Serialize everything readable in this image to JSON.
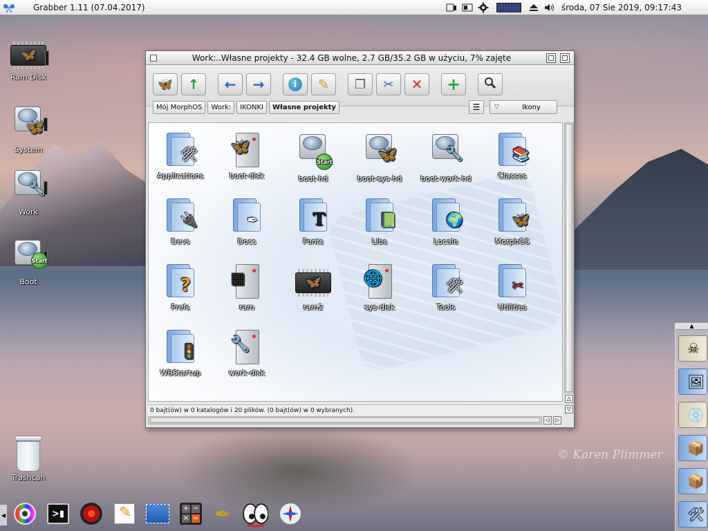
{
  "menubar": {
    "app_title": "Grabber 1.11 (07.04.2017)",
    "clock": "środa, 07 Sie 2019, 09:17:43"
  },
  "desktop": {
    "icons": [
      {
        "label": "Ram Disk",
        "kind": "chip"
      },
      {
        "label": "System",
        "kind": "drive"
      },
      {
        "label": "Work",
        "kind": "drive"
      },
      {
        "label": "Boot",
        "kind": "drive-start"
      },
      {
        "label": "Trashcan",
        "kind": "trash"
      }
    ],
    "watermark": "© Karen Plimmer"
  },
  "window": {
    "title": "Work:..Własne projekty - 32.4 GB wolne, 2.7 GB/35.2 GB w użyciu, 7% zajęte",
    "breadcrumbs": [
      "Mój MorphOS",
      "Work:",
      "IKONKI",
      "Własne projekty"
    ],
    "view_mode": "Ikony",
    "status": "0 bajt(ów) w 0 katalogów i 20 plików. (0 bajt(ów) w 0 wybranych).",
    "items": [
      {
        "label": "Applications",
        "kind": "folder",
        "emblem": "🛠"
      },
      {
        "label": "boot-disk",
        "kind": "tower",
        "emblem": "🦋"
      },
      {
        "label": "boot-hd",
        "kind": "drive-start"
      },
      {
        "label": "boot-sys-hd",
        "kind": "drive-fly"
      },
      {
        "label": "boot-work-hd",
        "kind": "drive-tools"
      },
      {
        "label": "Classes",
        "kind": "folder",
        "emblem": "📚"
      },
      {
        "label": "Devs",
        "kind": "folder",
        "emblem": "🔌"
      },
      {
        "label": "Docs",
        "kind": "folder",
        "emblem": "✒"
      },
      {
        "label": "Fonts",
        "kind": "folder",
        "emblem": "T"
      },
      {
        "label": "Libs",
        "kind": "folder",
        "emblem": "📗"
      },
      {
        "label": "Locale",
        "kind": "folder",
        "emblem": "🌍"
      },
      {
        "label": "MorphOS",
        "kind": "folder",
        "emblem": "🦋"
      },
      {
        "label": "Prefs",
        "kind": "folder",
        "emblem": "?"
      },
      {
        "label": "ram",
        "kind": "tower",
        "emblem": "▦"
      },
      {
        "label": "ram2",
        "kind": "chip"
      },
      {
        "label": "sys-disk",
        "kind": "tower",
        "emblem": "🌐"
      },
      {
        "label": "Tools",
        "kind": "folder",
        "emblem": "🛠"
      },
      {
        "label": "Utilities",
        "kind": "folder",
        "emblem": "✂"
      },
      {
        "label": "WBStartup",
        "kind": "folder",
        "emblem": "🚦"
      },
      {
        "label": "work-disk",
        "kind": "tower",
        "emblem": "🔧"
      }
    ]
  },
  "toolbar": {
    "buttons": [
      {
        "name": "morphos-button",
        "glyph": "🦋",
        "color": "#3a7fd5"
      },
      {
        "name": "parent-button",
        "glyph": "↑",
        "color": "#1fa04a"
      },
      {
        "name": "back-button",
        "glyph": "←",
        "color": "#2a62c9"
      },
      {
        "name": "forward-button",
        "glyph": "→",
        "color": "#2a62c9"
      },
      {
        "name": "info-button",
        "glyph": "i",
        "color": "#1f8fd0"
      },
      {
        "name": "rename-button",
        "glyph": "✎",
        "color": "#d89a18"
      },
      {
        "name": "copy-button",
        "glyph": "❐",
        "color": "#555555"
      },
      {
        "name": "cut-button",
        "glyph": "✂",
        "color": "#3a60b0"
      },
      {
        "name": "delete-button",
        "glyph": "✕",
        "color": "#d42a2a"
      },
      {
        "name": "new-drawer-button",
        "glyph": "+",
        "color": "#2aaa3a"
      },
      {
        "name": "search-button",
        "glyph": "🔍",
        "color": "#333333"
      }
    ]
  },
  "dock": {
    "bottom": [
      "color-wheel-icon",
      "shell-icon",
      "radar-icon",
      "notepad-icon",
      "screenshot-icon",
      "calculator-icon",
      "pen-icon",
      "eyes-icon",
      "compass-icon"
    ],
    "right": [
      "pirate-folder-icon",
      "pictures-folder-icon",
      "cd-folder-icon",
      "mail-folder-icon",
      "package-folder-icon",
      "tools-folder-icon"
    ]
  }
}
